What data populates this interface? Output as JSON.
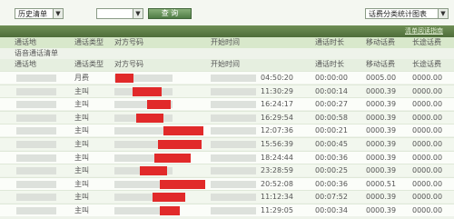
{
  "toolbar": {
    "history_select": "历史清单",
    "query_button": "查 询",
    "stats_select": "话费分类统计图表"
  },
  "note_link": "清单阅读指南",
  "columns": [
    "通话地",
    "通话类型",
    "对方号码",
    "开始时间",
    "通话时长",
    "移动话费",
    "长途话费"
  ],
  "section_title": "语音通话清单",
  "rows": [
    {
      "type": "月费",
      "time": "04:50:20",
      "dur": "00:00:00",
      "fee": "0005.00",
      "ld": "0000.00"
    },
    {
      "type": "主叫",
      "time": "11:30:29",
      "dur": "00:00:14",
      "fee": "0000.39",
      "ld": "0000.00"
    },
    {
      "type": "主叫",
      "time": "16:24:17",
      "dur": "00:00:27",
      "fee": "0000.39",
      "ld": "0000.00"
    },
    {
      "type": "主叫",
      "time": "16:29:54",
      "dur": "00:00:58",
      "fee": "0000.39",
      "ld": "0000.00"
    },
    {
      "type": "主叫",
      "time": "12:07:36",
      "dur": "00:00:21",
      "fee": "0000.39",
      "ld": "0000.00"
    },
    {
      "type": "主叫",
      "time": "15:56:39",
      "dur": "00:00:45",
      "fee": "0000.39",
      "ld": "0000.00"
    },
    {
      "type": "主叫",
      "time": "18:24:44",
      "dur": "00:00:36",
      "fee": "0000.39",
      "ld": "0000.00"
    },
    {
      "type": "主叫",
      "time": "23:28:59",
      "dur": "00:00:25",
      "fee": "0000.39",
      "ld": "0000.00"
    },
    {
      "type": "主叫",
      "time": "20:52:08",
      "dur": "00:00:36",
      "fee": "0000.51",
      "ld": "0000.00"
    },
    {
      "type": "主叫",
      "time": "11:12:34",
      "dur": "00:07:52",
      "fee": "0000.39",
      "ld": "0000.00"
    },
    {
      "type": "主叫",
      "time": "11:29:05",
      "dur": "00:00:34",
      "fee": "0000.39",
      "ld": "0000.00"
    }
  ]
}
